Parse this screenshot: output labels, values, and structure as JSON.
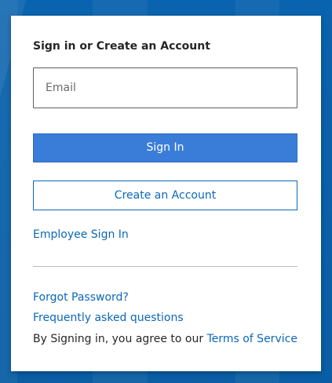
{
  "form": {
    "heading": "Sign in or Create an Account",
    "email_placeholder": "Email",
    "email_value": "",
    "sign_in_label": "Sign In",
    "create_account_label": "Create an Account",
    "employee_sign_in_label": "Employee Sign In"
  },
  "help": {
    "forgot_password_label": "Forgot Password?",
    "faq_label": "Frequently asked questions",
    "terms_prefix": "By Signing in, you agree to our ",
    "terms_link_label": "Terms of Service"
  },
  "colors": {
    "background": "#0b68b7",
    "primary_button": "#3a7dd8",
    "link": "#0b68b7",
    "card": "#ffffff"
  }
}
